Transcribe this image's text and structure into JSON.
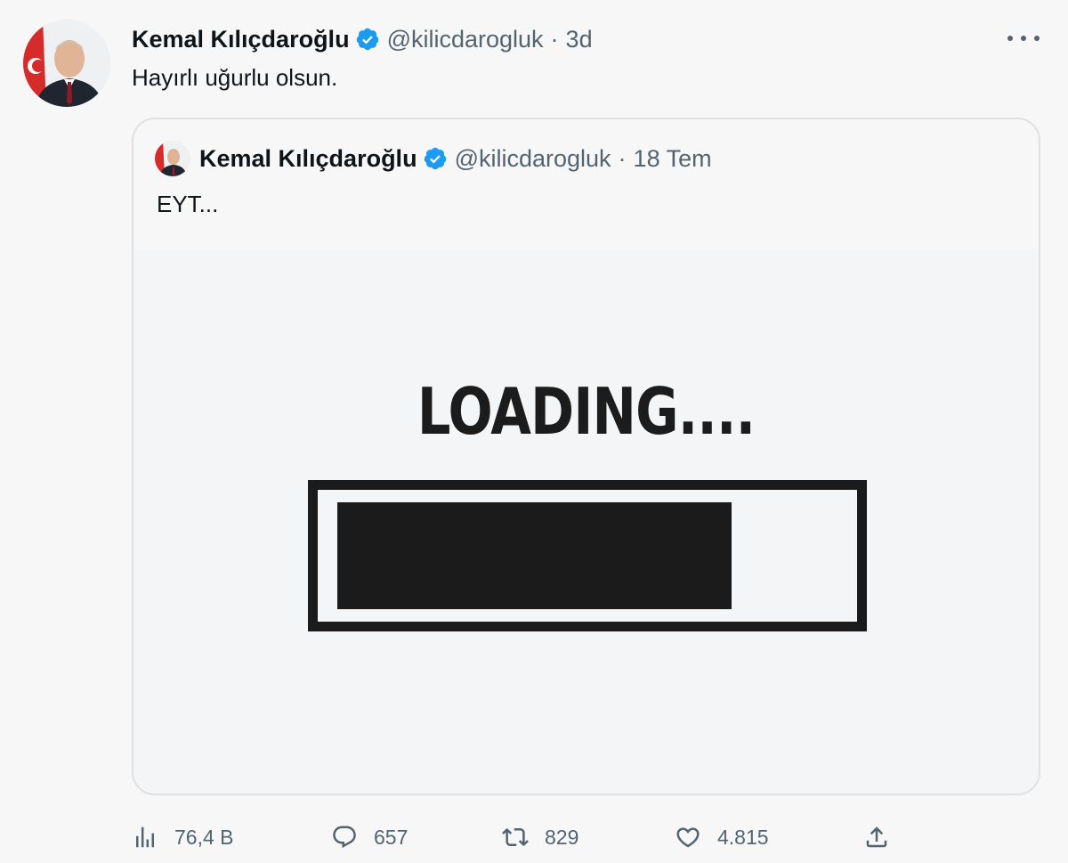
{
  "tweet": {
    "author_name": "Kemal Kılıçdaroğlu",
    "handle": "@kilicdarogluk",
    "separator": "·",
    "time": "3d",
    "text": "Hayırlı uğurlu olsun."
  },
  "quoted_tweet": {
    "author_name": "Kemal Kılıçdaroğlu",
    "handle": "@kilicdarogluk",
    "separator": "·",
    "time": "18 Tem",
    "text": "EYT...",
    "media": {
      "loading_text": "LOADING....",
      "progress_fraction": 0.78
    }
  },
  "actions": {
    "views": "76,4 B",
    "replies": "657",
    "retweets": "829",
    "likes": "4.815"
  },
  "colors": {
    "verified_badge": "#1d9bf0",
    "secondary_text": "#536471",
    "background": "#f7f7f8"
  },
  "icons": [
    "verified-icon",
    "more-icon",
    "views-icon",
    "reply-icon",
    "retweet-icon",
    "like-icon",
    "share-icon"
  ]
}
